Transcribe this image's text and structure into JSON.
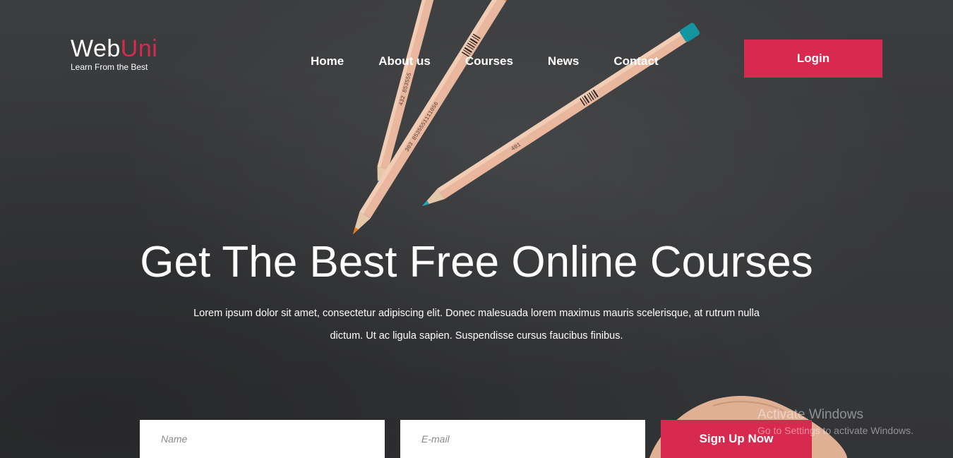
{
  "logo": {
    "name_main": "Web",
    "name_accent": "Uni",
    "tagline": "Learn From the Best"
  },
  "nav": {
    "items": [
      "Home",
      "About us",
      "Courses",
      "News",
      "Contact"
    ]
  },
  "header": {
    "login_label": "Login"
  },
  "hero": {
    "title": "Get The Best Free Online Courses",
    "description": "Lorem ipsum dolor sit amet, consectetur adipiscing elit. Donec malesuada lorem maximus mauris scelerisque, at rutrum nulla dictum. Ut ac ligula sapien. Suspendisse cursus faucibus finibus."
  },
  "signup": {
    "name_placeholder": "Name",
    "name_value": "",
    "email_placeholder": "E-mail",
    "email_value": "",
    "button_label": "Sign Up Now"
  },
  "watermark": {
    "title": "Activate Windows",
    "subtitle": "Go to Settings to activate Windows."
  },
  "colors": {
    "accent": "#d82a4e",
    "background": "#3a3b3d",
    "text": "#ffffff"
  },
  "icons": {
    "hero_art": "pencils-image"
  }
}
